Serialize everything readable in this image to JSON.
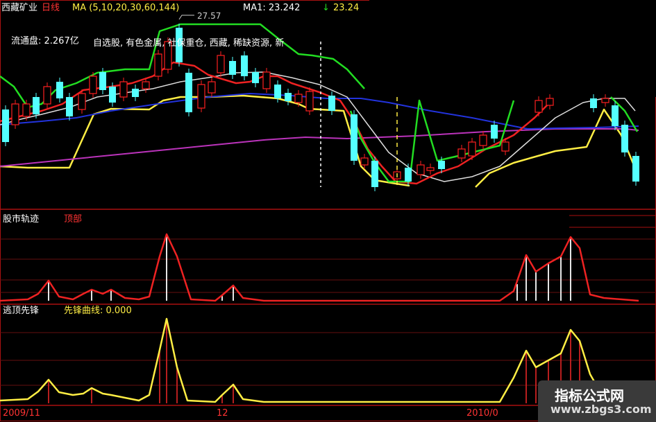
{
  "header": {
    "stock_name": "西藏矿业",
    "period": "日线",
    "ma_label": "MA (5,10,20,30,60,144)",
    "ma1_label": "MA1: 23.242",
    "ma1_arrow": "↓",
    "ma2_value": "23.24",
    "high_price": "27.57"
  },
  "info": {
    "float_shares": "流通盘: 2.267亿",
    "sectors": "自选股, 有色金属, 社保重仓, 西藏, 稀缺资源, 新"
  },
  "panel2": {
    "title": "股市轨迹",
    "subtitle": "顶部"
  },
  "panel3": {
    "title": "逃顶先锋",
    "curve_label": "先锋曲线: 0.000"
  },
  "x_axis": {
    "label1": "2009/11",
    "label2": "12",
    "label3": "2010/0"
  },
  "watermark": {
    "line1": "指标公式网",
    "line2": "www.zbgs3.com"
  },
  "colors": {
    "up": "#ff2020",
    "down": "#54ffff",
    "ma_green": "#22dd22",
    "ma_yellow": "#ffee44",
    "ma_white": "#dddddd",
    "ma_blue": "#2233dd",
    "ma_purple": "#bb33bb",
    "red_line": "#ee2222"
  }
}
